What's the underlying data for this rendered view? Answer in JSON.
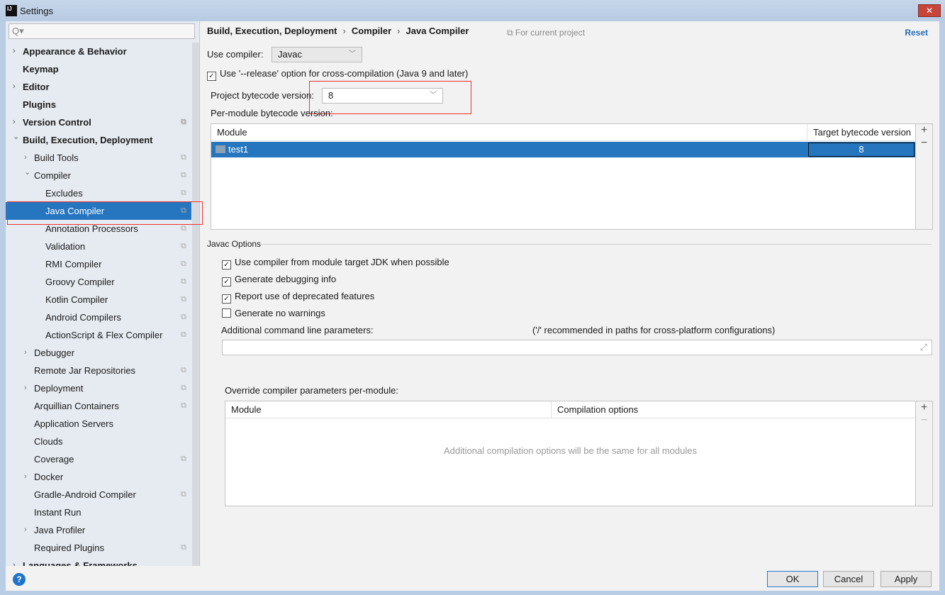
{
  "window": {
    "title": "Settings",
    "logo": "IJ",
    "close": "✕"
  },
  "search": {
    "placeholder": "Q▾"
  },
  "sidebar": {
    "items": [
      {
        "label": "Appearance & Behavior",
        "bold": true,
        "arrow": "right",
        "level": 0,
        "copy": false
      },
      {
        "label": "Keymap",
        "bold": true,
        "level": 0,
        "copy": false
      },
      {
        "label": "Editor",
        "bold": true,
        "arrow": "right",
        "level": 0,
        "copy": false
      },
      {
        "label": "Plugins",
        "bold": true,
        "level": 0,
        "copy": false
      },
      {
        "label": "Version Control",
        "bold": true,
        "arrow": "right",
        "level": 0,
        "copy": true
      },
      {
        "label": "Build, Execution, Deployment",
        "bold": true,
        "arrow": "down",
        "level": 0,
        "copy": false
      },
      {
        "label": "Build Tools",
        "arrow": "right",
        "level": 1,
        "copy": true
      },
      {
        "label": "Compiler",
        "arrow": "down",
        "level": 1,
        "copy": true
      },
      {
        "label": "Excludes",
        "level": 2,
        "copy": true
      },
      {
        "label": "Java Compiler",
        "level": 2,
        "copy": true,
        "selected": true
      },
      {
        "label": "Annotation Processors",
        "level": 2,
        "copy": true
      },
      {
        "label": "Validation",
        "level": 2,
        "copy": true
      },
      {
        "label": "RMI Compiler",
        "level": 2,
        "copy": true
      },
      {
        "label": "Groovy Compiler",
        "level": 2,
        "copy": true
      },
      {
        "label": "Kotlin Compiler",
        "level": 2,
        "copy": true
      },
      {
        "label": "Android Compilers",
        "level": 2,
        "copy": true
      },
      {
        "label": "ActionScript & Flex Compiler",
        "level": 2,
        "copy": true
      },
      {
        "label": "Debugger",
        "arrow": "right",
        "level": 1,
        "copy": false
      },
      {
        "label": "Remote Jar Repositories",
        "level": 1,
        "copy": true
      },
      {
        "label": "Deployment",
        "arrow": "right",
        "level": 1,
        "copy": true
      },
      {
        "label": "Arquillian Containers",
        "level": 1,
        "copy": true
      },
      {
        "label": "Application Servers",
        "level": 1,
        "copy": false
      },
      {
        "label": "Clouds",
        "level": 1,
        "copy": false
      },
      {
        "label": "Coverage",
        "level": 1,
        "copy": true
      },
      {
        "label": "Docker",
        "arrow": "right",
        "level": 1,
        "copy": false
      },
      {
        "label": "Gradle-Android Compiler",
        "level": 1,
        "copy": true
      },
      {
        "label": "Instant Run",
        "level": 1,
        "copy": false
      },
      {
        "label": "Java Profiler",
        "arrow": "right",
        "level": 1,
        "copy": false
      },
      {
        "label": "Required Plugins",
        "level": 1,
        "copy": true
      },
      {
        "label": "Languages & Frameworks",
        "bold": true,
        "arrow": "right",
        "level": 0,
        "copy": false
      }
    ]
  },
  "breadcrumb": [
    "Build, Execution, Deployment",
    "Compiler",
    "Java Compiler"
  ],
  "for_current_project": "For current project",
  "reset": "Reset",
  "use_compiler": {
    "label": "Use compiler:",
    "value": "Javac"
  },
  "release_option": {
    "label": "Use '--release' option for cross-compilation (Java 9 and later)",
    "checked": true
  },
  "project_bytecode": {
    "label": "Project bytecode version:",
    "value": "8"
  },
  "per_module": {
    "label": "Per-module bytecode version:",
    "columns": [
      "Module",
      "Target bytecode version"
    ],
    "rows": [
      {
        "module": "test1",
        "version": "8"
      }
    ]
  },
  "javac_options": {
    "title": "Javac Options",
    "checks": [
      {
        "label": "Use compiler from module target JDK when possible",
        "checked": true
      },
      {
        "label": "Generate debugging info",
        "checked": true
      },
      {
        "label": "Report use of deprecated features",
        "checked": true
      },
      {
        "label": "Generate no warnings",
        "checked": false
      }
    ],
    "additional_label": "Additional command line parameters:",
    "additional_hint": "('/' recommended in paths for cross-platform configurations)",
    "additional_value": ""
  },
  "override": {
    "label": "Override compiler parameters per-module:",
    "columns": [
      "Module",
      "Compilation options"
    ],
    "empty": "Additional compilation options will be the same for all modules"
  },
  "buttons": {
    "ok": "OK",
    "cancel": "Cancel",
    "apply": "Apply",
    "help": "?"
  },
  "colors": {
    "selection": "#2675bf",
    "accent_link": "#2a6db7",
    "highlight_box": "#ee3333"
  }
}
